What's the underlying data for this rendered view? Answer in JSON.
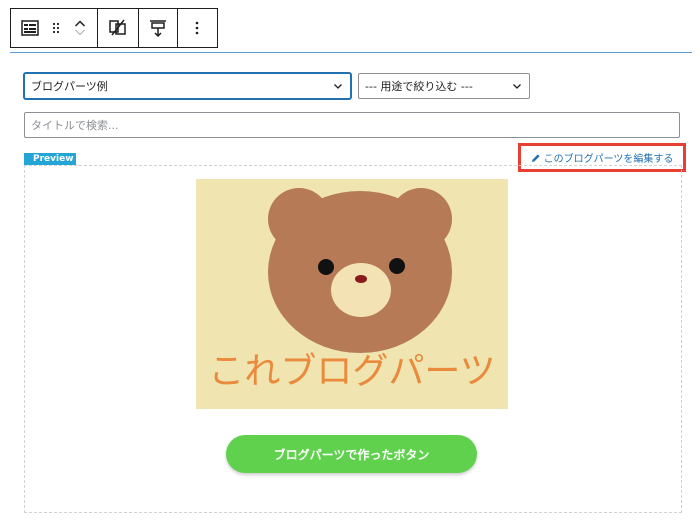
{
  "toolbar": {
    "items": [
      "block-type-icon",
      "drag-handle-icon",
      "move-up-icon",
      "move-down-icon",
      "transform-icon",
      "align-icon",
      "more-options-icon"
    ]
  },
  "selects": {
    "blog_parts": {
      "value": "ブログパーツ例"
    },
    "usage_filter": {
      "value": "--- 用途で絞り込む ---"
    }
  },
  "search": {
    "placeholder": "タイトルで検索..."
  },
  "preview": {
    "tag": "Preview",
    "edit_link": "このブログパーツを編集する",
    "image_text": "これブログパーツ",
    "button_label": "ブログパーツで作ったボタン"
  },
  "colors": {
    "accent": "#2271b1",
    "preview_tag": "#23a6d5",
    "highlight": "#e83f35",
    "button": "#5fd14c",
    "image_bg": "#f0e4b0",
    "bear": "#b77a57"
  }
}
